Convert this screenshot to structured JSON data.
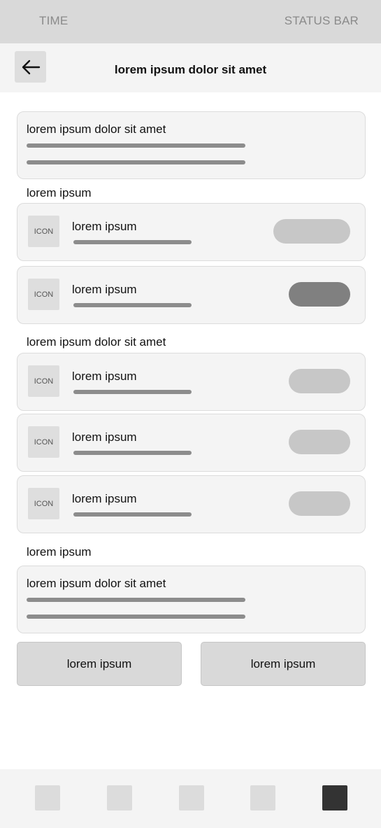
{
  "status_bar": {
    "time": "TIME",
    "status": "STATUS BAR"
  },
  "header": {
    "title": "lorem ipsum dolor sit amet",
    "back_icon": "arrow-left-icon"
  },
  "info_card_top": {
    "title": "lorem ipsum dolor sit amet"
  },
  "section_1": {
    "label": "lorem ipsum",
    "rows": [
      {
        "icon_label": "ICON",
        "title": "lorem ipsum",
        "toggle": "off"
      },
      {
        "icon_label": "ICON",
        "title": "lorem ipsum",
        "toggle": "on"
      }
    ]
  },
  "section_2": {
    "label": "lorem ipsum dolor sit amet",
    "rows": [
      {
        "icon_label": "ICON",
        "title": "lorem ipsum",
        "toggle": "off"
      },
      {
        "icon_label": "ICON",
        "title": "lorem ipsum",
        "toggle": "off"
      },
      {
        "icon_label": "ICON",
        "title": "lorem ipsum",
        "toggle": "off"
      }
    ]
  },
  "section_3": {
    "label": "lorem ipsum"
  },
  "info_card_bottom": {
    "title": "lorem ipsum dolor sit amet"
  },
  "actions": {
    "left_label": "lorem ipsum",
    "right_label": "lorem ipsum"
  },
  "bottom_nav": {
    "active_index": 4,
    "items": [
      "nav-item-1",
      "nav-item-2",
      "nav-item-3",
      "nav-item-4",
      "nav-item-5"
    ]
  },
  "colors": {
    "active_toggle": "#808080",
    "inactive_toggle": "#c7c7c7",
    "active_nav": "#333333",
    "inactive_nav": "#dcdcdc"
  }
}
